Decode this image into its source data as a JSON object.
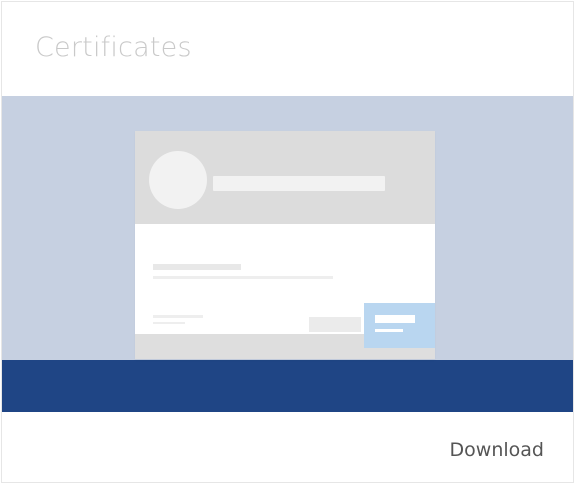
{
  "card": {
    "title": "Certificates",
    "download_label": "Download"
  },
  "colors": {
    "illustration_background": "#c6d0e1",
    "illustration_band": "#1f4585",
    "document_header": "#dcdcdc",
    "document_button": "#b9d6f0",
    "title_text": "#c9c9c9",
    "link_text": "#555555"
  }
}
